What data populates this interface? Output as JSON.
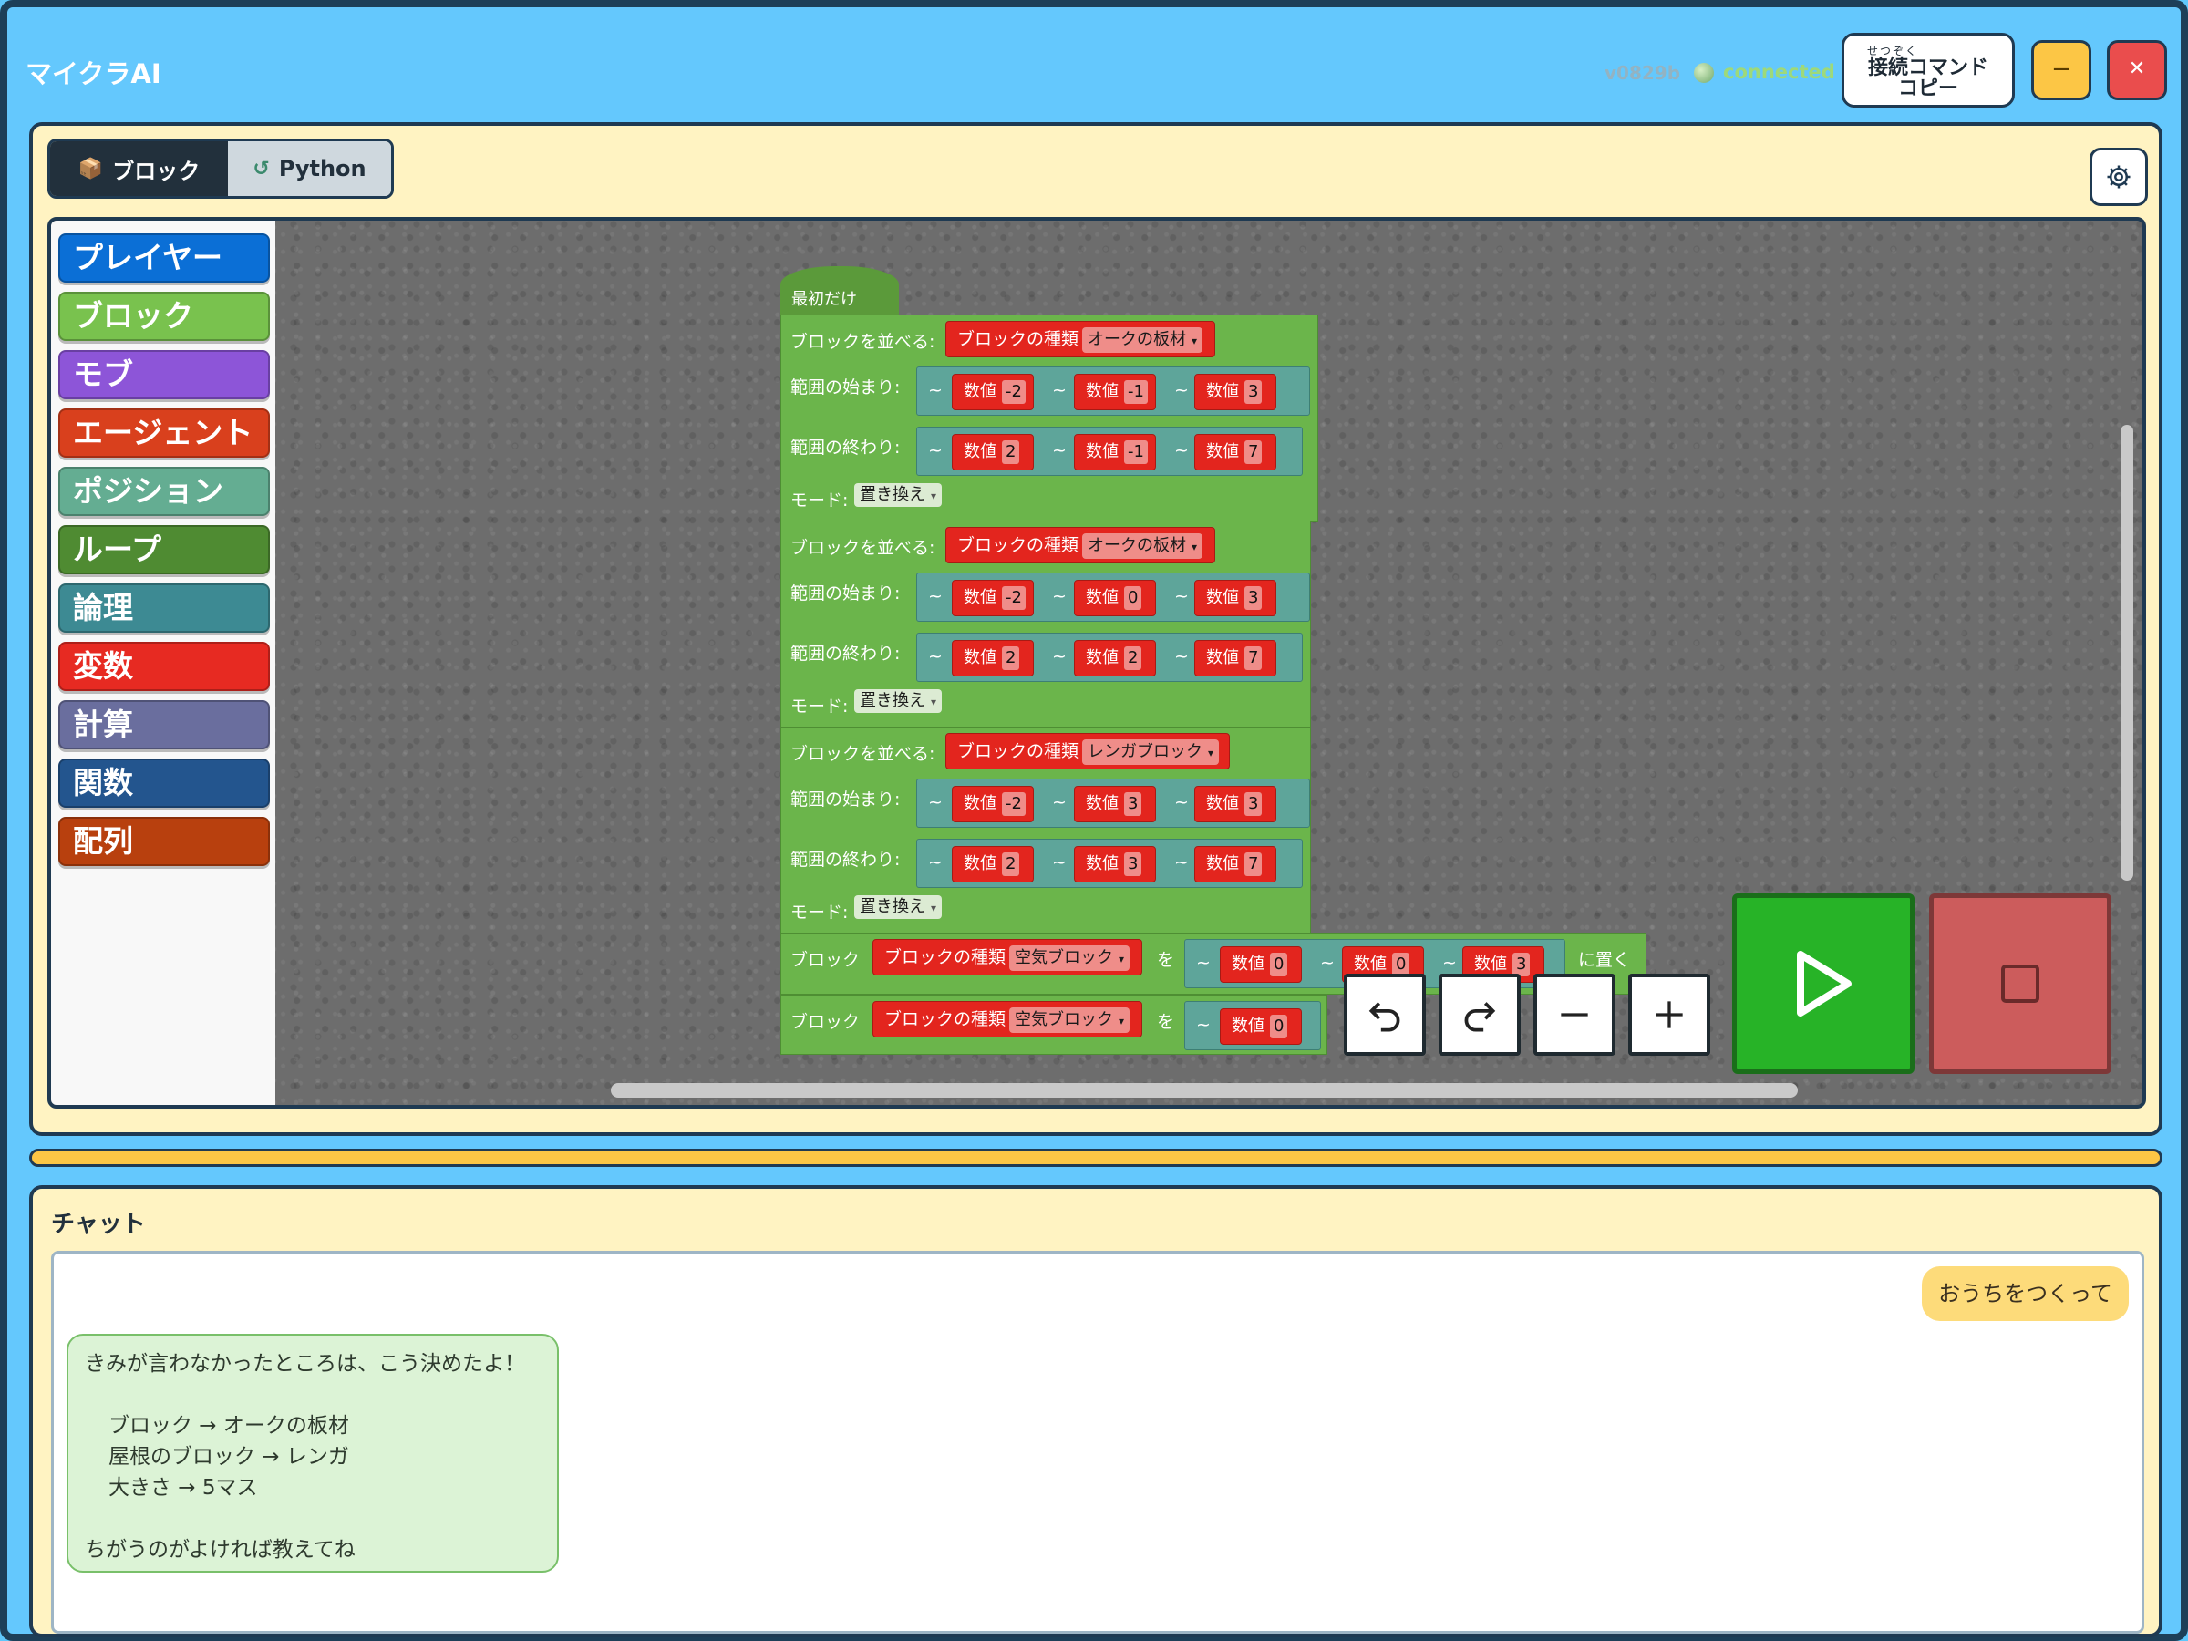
{
  "app": {
    "title": "マイクラAI",
    "version": "v0829b",
    "status": "connected",
    "copy_button_ruby": "せつぞく",
    "copy_button_line1": "接続コマンド",
    "copy_button_line2": "コピー",
    "minimize_label": "−",
    "close_label": "✕"
  },
  "tabs": {
    "blocks_label": "ブロック",
    "python_label": "Python"
  },
  "toolbox": {
    "categories": [
      {
        "label": "プレイヤー",
        "color": "#0b6fd6"
      },
      {
        "label": "ブロック",
        "color": "#79c24e"
      },
      {
        "label": "モブ",
        "color": "#8d55d8"
      },
      {
        "label": "エージェント",
        "color": "#d9401d"
      },
      {
        "label": "ポジション",
        "color": "#64ad92"
      },
      {
        "label": "ループ",
        "color": "#4f8b32"
      },
      {
        "label": "論理",
        "color": "#3d8a93"
      },
      {
        "label": "変数",
        "color": "#e72a22"
      },
      {
        "label": "計算",
        "color": "#6a6e9e"
      },
      {
        "label": "関数",
        "color": "#23558e"
      },
      {
        "label": "配列",
        "color": "#b8400e"
      }
    ]
  },
  "script": {
    "hat_label": "最初だけ",
    "fill_label": "ブロックを並べる:",
    "block_type_label": "ブロックの種類",
    "start_label": "範囲の始まり:",
    "end_label": "範囲の終わり:",
    "mode_label": "モード:",
    "mode_value": "置き換え",
    "number_label": "数値",
    "tilde": "~",
    "place_block_label": "ブロック",
    "wo_label": "を",
    "place_suffix": "に置く",
    "fills": [
      {
        "block": "オークの板材",
        "start": [
          "-2",
          "-1",
          "3"
        ],
        "end": [
          "2",
          "-1",
          "7"
        ]
      },
      {
        "block": "オークの板材",
        "start": [
          "-2",
          "0",
          "3"
        ],
        "end": [
          "2",
          "2",
          "7"
        ]
      },
      {
        "block": "レンガブロック",
        "start": [
          "-2",
          "3",
          "3"
        ],
        "end": [
          "2",
          "3",
          "7"
        ]
      }
    ],
    "places": [
      {
        "block": "空気ブロック",
        "pos": [
          "0",
          "0",
          "3"
        ]
      },
      {
        "block": "空気ブロック",
        "pos": [
          "0"
        ]
      }
    ]
  },
  "chat": {
    "title": "チャット",
    "user_message": "おうちをつくって",
    "ai_lines": [
      "きみが言わなかったところは、こう決めたよ！",
      "",
      "ブロック → オークの板材",
      "屋根のブロック → レンガ",
      "大きさ → 5マス",
      "",
      "ちがうのがよければ教えてね"
    ]
  }
}
